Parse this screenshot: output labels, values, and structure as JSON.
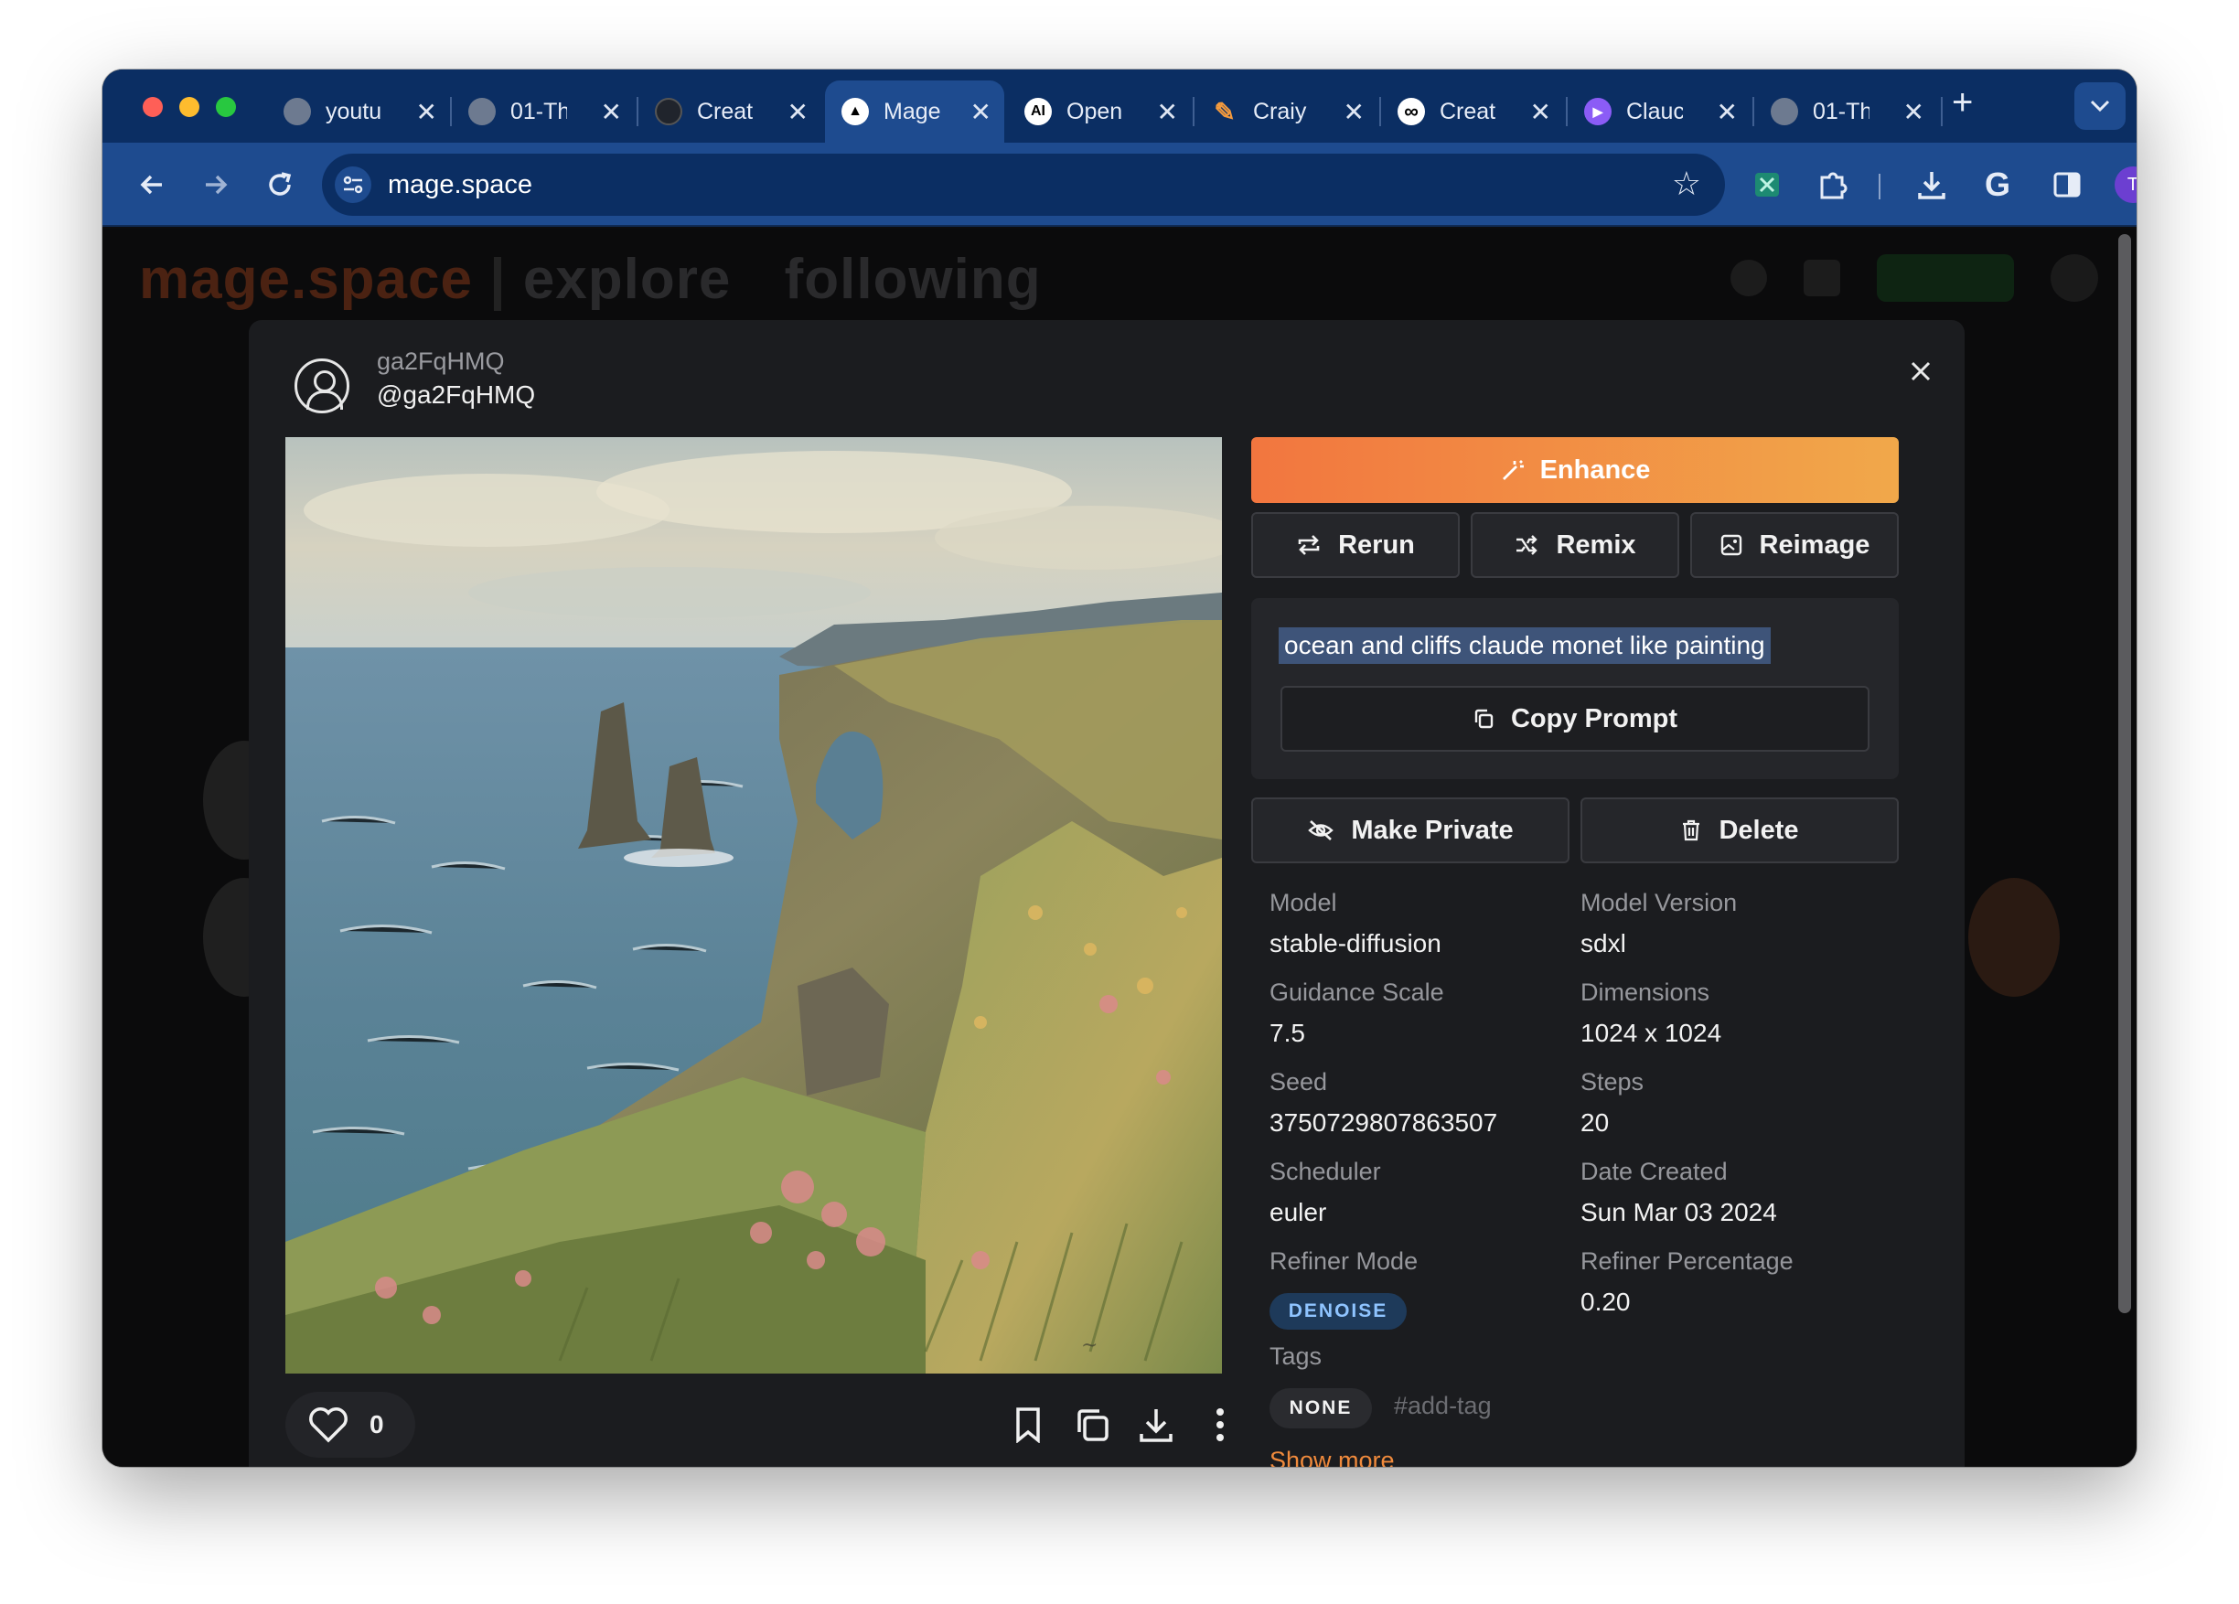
{
  "browser": {
    "tabs": [
      {
        "title": "youtu",
        "favicon": "globe-icon"
      },
      {
        "title": "01-Th",
        "favicon": "globe-icon"
      },
      {
        "title": "Creat",
        "favicon": "circle-logo-icon"
      },
      {
        "title": "Mage",
        "favicon": "triangle-logo-icon",
        "active": true
      },
      {
        "title": "Open",
        "favicon": "ai-logo-icon"
      },
      {
        "title": "Craiy",
        "favicon": "pencil-icon"
      },
      {
        "title": "Creat",
        "favicon": "infinity-icon"
      },
      {
        "title": "Clauc",
        "favicon": "play-icon"
      },
      {
        "title": "01-Th",
        "favicon": "globe-icon"
      }
    ],
    "close_glyph": "✕",
    "new_tab_glyph": "+",
    "url": "mage.space",
    "profile_initial": "T"
  },
  "background": {
    "logo": "mage.space",
    "nav": [
      "explore",
      "following"
    ]
  },
  "modal": {
    "username": "ga2FqHMQ",
    "handle": "@ga2FqHMQ",
    "likes": "0",
    "buttons": {
      "enhance": "Enhance",
      "rerun": "Rerun",
      "remix": "Remix",
      "reimage": "Reimage",
      "copy_prompt": "Copy Prompt",
      "make_private": "Make Private",
      "delete": "Delete"
    },
    "prompt": "ocean and cliffs claude monet like painting",
    "meta": {
      "model_label": "Model",
      "model": "stable-diffusion",
      "model_version_label": "Model Version",
      "model_version": "sdxl",
      "guidance_label": "Guidance Scale",
      "guidance": "7.5",
      "dimensions_label": "Dimensions",
      "dimensions": "1024 x 1024",
      "seed_label": "Seed",
      "seed": "3750729807863507",
      "steps_label": "Steps",
      "steps": "20",
      "scheduler_label": "Scheduler",
      "scheduler": "euler",
      "date_label": "Date Created",
      "date": "Sun Mar 03 2024",
      "refiner_mode_label": "Refiner Mode",
      "refiner_mode": "DENOISE",
      "refiner_pct_label": "Refiner Percentage",
      "refiner_pct": "0.20",
      "tags_label": "Tags",
      "tag_none": "NONE",
      "add_tag": "#add-tag",
      "show_more": "Show more"
    }
  },
  "colors": {
    "tabstrip": "#0b2e63",
    "toolbar": "#1e4b8f",
    "modal": "#1b1c1f",
    "accent_start": "#f2763f",
    "accent_end": "#f1a84a",
    "link": "#f08a3c"
  }
}
